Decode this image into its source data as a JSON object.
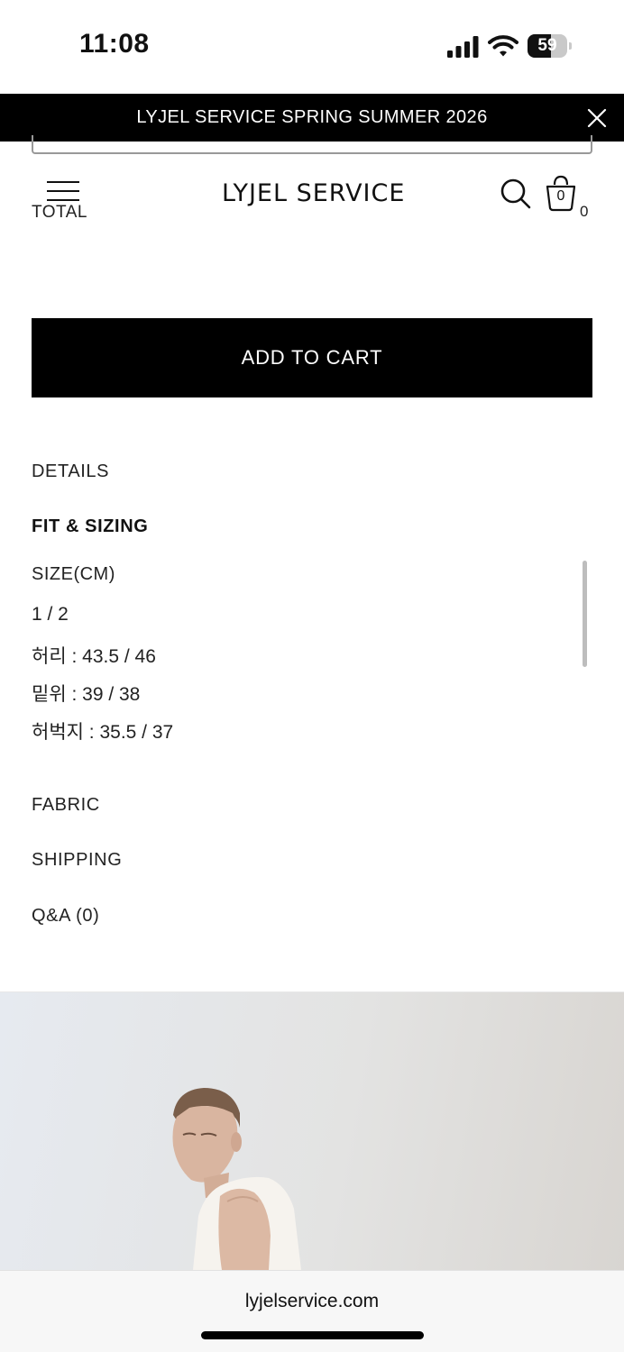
{
  "status_bar": {
    "time": "11:08",
    "battery_percent": "59",
    "battery_level": 0.59,
    "icons": [
      "cellular-signal-icon",
      "wifi-icon",
      "battery-icon"
    ]
  },
  "announcement": {
    "text": "LYJEL SERVICE SPRING SUMMER 2026",
    "close_icon": "close-icon"
  },
  "header": {
    "total_label": "TOTAL",
    "logo": "LYJEL SERVICE",
    "cart_badge": "0",
    "cart_count": "0",
    "icons": [
      "menu-icon",
      "search-icon",
      "bag-icon"
    ]
  },
  "product": {
    "add_to_cart": "ADD TO CART"
  },
  "accordion": {
    "details": "DETAILS",
    "fit_sizing": "FIT & SIZING",
    "fit_content": {
      "size_header": "SIZE(CM)",
      "sizes": "1 / 2",
      "waist": "허리 : 43.5 / 46",
      "rise": "밑위 : 39 / 38",
      "thigh": "허벅지 : 35.5 / 37"
    },
    "fabric": "FABRIC",
    "shipping": "SHIPPING",
    "qa": "Q&A (0)"
  },
  "browser": {
    "url": "lyjelservice.com"
  },
  "colors": {
    "black": "#000000",
    "text": "#222222",
    "background": "#ffffff",
    "photo_bg": "#e3e3e2"
  }
}
